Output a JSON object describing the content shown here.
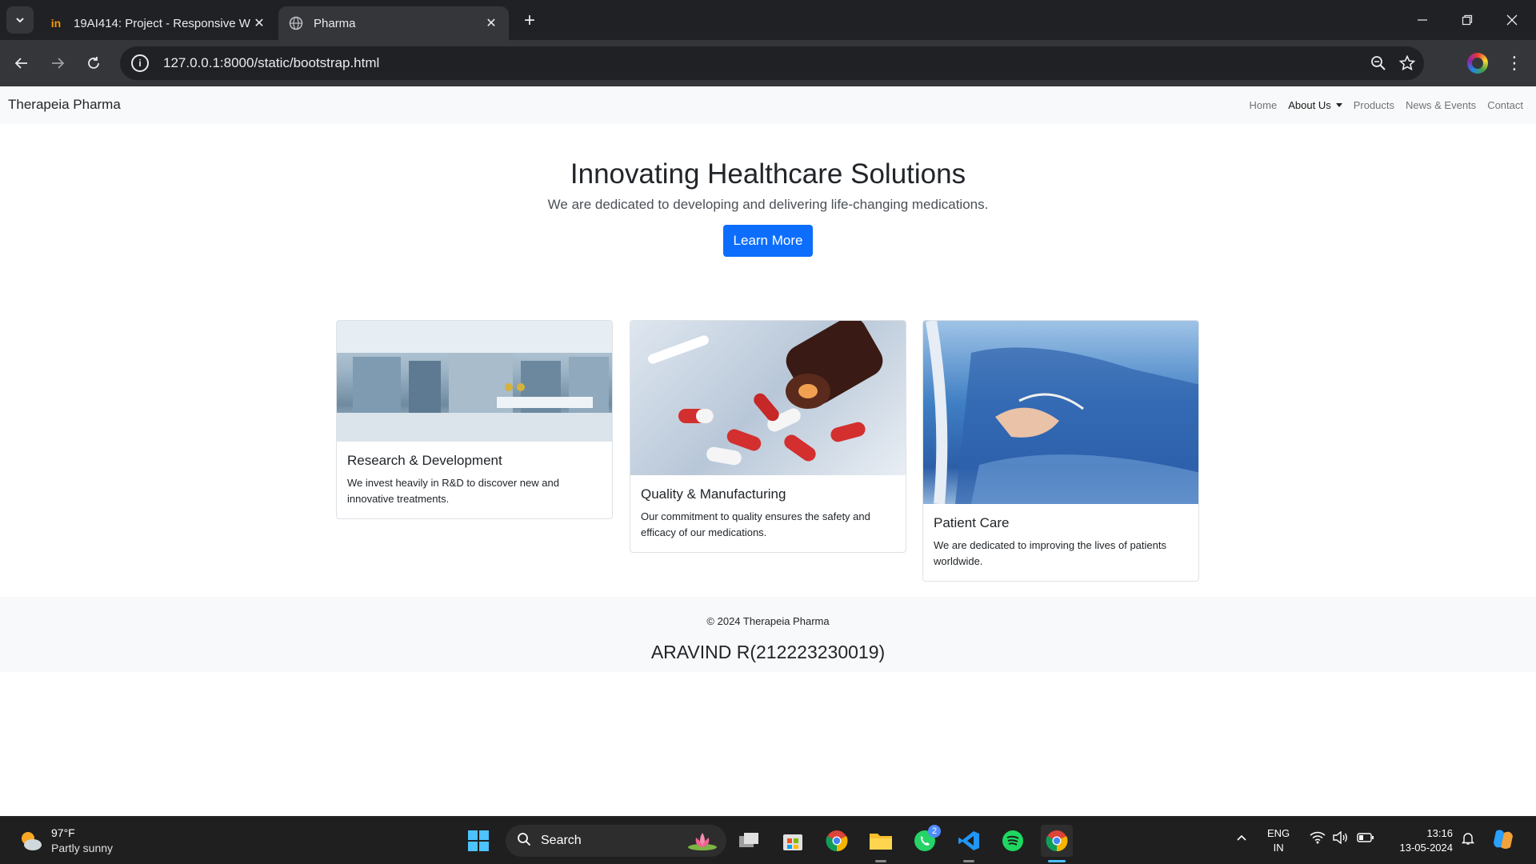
{
  "browser": {
    "tabs": [
      {
        "title": "19AI414: Project - Responsive W",
        "favicon": "in-logo-icon",
        "active": false
      },
      {
        "title": "Pharma",
        "favicon": "globe-icon",
        "active": true
      }
    ],
    "url": "127.0.0.1:8000/static/bootstrap.html"
  },
  "site": {
    "brand": "Therapeia Pharma",
    "nav": {
      "home": "Home",
      "about": "About Us",
      "products": "Products",
      "news": "News & Events",
      "contact": "Contact"
    },
    "hero": {
      "title": "Innovating Healthcare Solutions",
      "subtitle": "We are dedicated to developing and delivering life-changing medications.",
      "button": "Learn More"
    },
    "cards": [
      {
        "title": "Research & Development",
        "text": "We invest heavily in R&D to discover new and innovative treatments.",
        "image": "laboratory"
      },
      {
        "title": "Quality & Manufacturing",
        "text": "Our commitment to quality ensures the safety and efficacy of our medications.",
        "image": "pills"
      },
      {
        "title": "Patient Care",
        "text": "We are dedicated to improving the lives of patients worldwide.",
        "image": "patient-in-bed"
      }
    ],
    "footer": {
      "copyright": "© 2024 Therapeia Pharma",
      "author": "ARAVIND R(212223230019)"
    }
  },
  "taskbar": {
    "weather": {
      "temp": "97°F",
      "desc": "Partly sunny"
    },
    "search_label": "Search",
    "whatsapp_badge": "2",
    "lang": {
      "line1": "ENG",
      "line2": "IN"
    },
    "clock": {
      "time": "13:16",
      "date": "13-05-2024"
    }
  },
  "colors": {
    "primary_button": "#0d6efd",
    "navbar_bg": "#f8f9fa",
    "chrome_dark": "#202124"
  }
}
